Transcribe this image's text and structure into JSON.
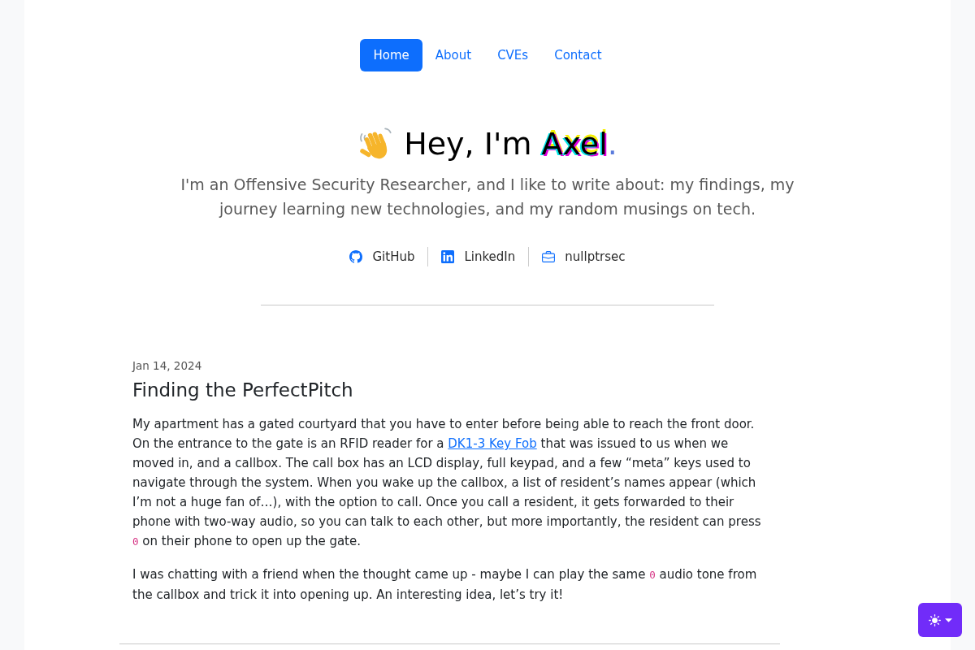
{
  "nav": [
    {
      "label": "Home",
      "selected": true
    },
    {
      "label": "About",
      "selected": false
    },
    {
      "label": "CVEs",
      "selected": false
    },
    {
      "label": "Contact",
      "selected": false
    }
  ],
  "hero": {
    "greeting": "Hey, I'm",
    "name": "Axel",
    "name_end": ".",
    "tagline": "I'm an Offensive Security Researcher, and I like to write about: my findings, my journey learning new technologies, and my random musings on tech."
  },
  "social_links": [
    {
      "kind": "github",
      "label": "GitHub"
    },
    {
      "kind": "linkedin",
      "label": "LinkedIn"
    },
    {
      "kind": "briefcase",
      "label": "nullptrsec"
    }
  ],
  "post": {
    "date": "Jan 14, 2024",
    "title": "Finding the PerfectPitch",
    "paragraphs": [
      [
        {
          "kind": "text",
          "text": "My apartment has a gated courtyard that you have to enter before being able to reach the front door. On the entrance to the gate is an RFID reader for a "
        },
        {
          "kind": "link",
          "text": "DK1-3 Key Fob"
        },
        {
          "kind": "text",
          "text": " that was issued to us when we moved in, and a callbox. The call box has an LCD display, full keypad, and a few “meta” keys used to navigate through the system. When you wake up the callbox, a list of resident’s names appear (which I’m not a huge fan of…), with the option to call. Once you call a resident, it gets forwarded to their phone with two-way audio, so you can talk to each other, but more importantly, the resident can press "
        },
        {
          "kind": "code",
          "text": "0"
        },
        {
          "kind": "text",
          "text": " on their phone to open up the gate."
        }
      ],
      [
        {
          "kind": "text",
          "text": "I was chatting with a friend when the thought came up - maybe I can play the same "
        },
        {
          "kind": "code",
          "text": "0"
        },
        {
          "kind": "text",
          "text": " audio tone from the callbox and trick it into opening up. An interesting idea, let’s try it!"
        }
      ]
    ]
  }
}
